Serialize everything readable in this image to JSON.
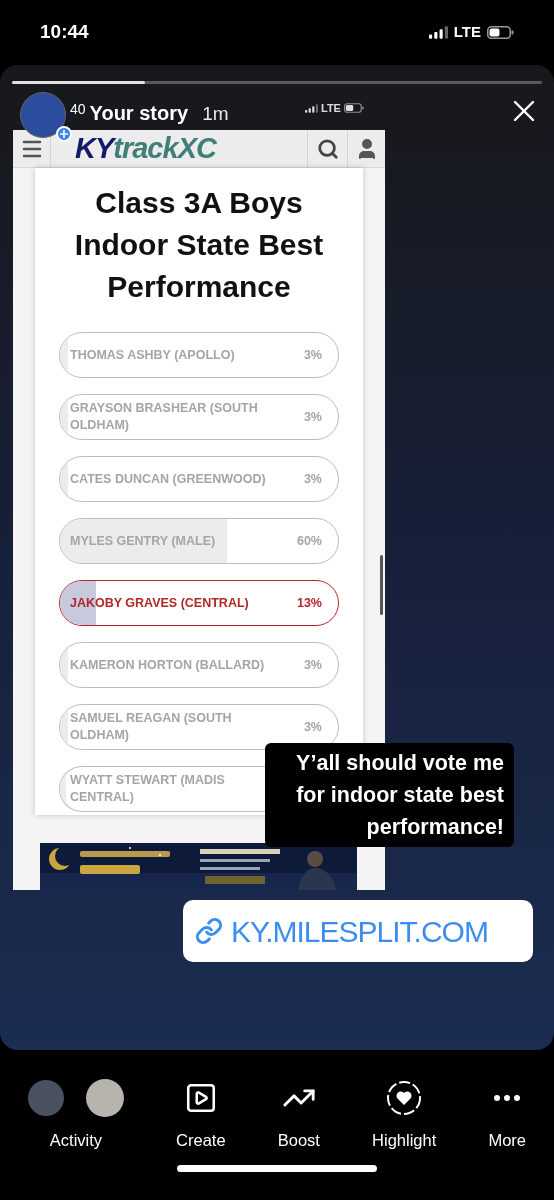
{
  "status_bar": {
    "time": "10:44",
    "network": "LTE"
  },
  "story": {
    "progress": {
      "level": 0.25
    },
    "hidden_time": "40",
    "title": "Your story",
    "age": "1m",
    "inner_network": "LTE"
  },
  "site": {
    "logo_prefix": "KY",
    "logo_rest": "trackXC"
  },
  "poll": {
    "title": "Class 3A Boys Indoor State Best Performance",
    "options": [
      {
        "lines": [
          "THOMAS ASHBY (APOLLO)"
        ],
        "percent": "3%",
        "level": 0.03,
        "selected": false
      },
      {
        "lines": [
          "GRAYSON BRASHEAR (SOUTH",
          "OLDHAM)"
        ],
        "percent": "3%",
        "level": 0.03,
        "selected": false
      },
      {
        "lines": [
          "CATES DUNCAN (GREENWOOD)"
        ],
        "percent": "3%",
        "level": 0.03,
        "selected": false
      },
      {
        "lines": [
          "MYLES GENTRY (MALE)"
        ],
        "percent": "60%",
        "level": 0.6,
        "selected": false
      },
      {
        "lines": [
          "JAKOBY GRAVES (CENTRAL)"
        ],
        "percent": "13%",
        "level": 0.13,
        "selected": true
      },
      {
        "lines": [
          "KAMERON HORTON (BALLARD)"
        ],
        "percent": "3%",
        "level": 0.03,
        "selected": false
      },
      {
        "lines": [
          "SAMUEL REAGAN (SOUTH",
          "OLDHAM)"
        ],
        "percent": "3%",
        "level": 0.03,
        "selected": false
      },
      {
        "lines": [
          "WYATT STEWART (MADIS",
          "CENTRAL)"
        ],
        "level": 0.03,
        "selected": false
      }
    ]
  },
  "caption": {
    "lines": [
      "Y’all should vote me",
      "for indoor state best",
      "performance!"
    ]
  },
  "link_sticker": {
    "text": "KY.MILESPLIT.COM"
  },
  "bottom_bar": {
    "items": [
      {
        "kind": "avatars",
        "label": "Activity"
      },
      {
        "kind": "create",
        "label": "Create"
      },
      {
        "kind": "boost",
        "label": "Boost"
      },
      {
        "kind": "highlight",
        "label": "Highlight"
      },
      {
        "kind": "more",
        "label": "More"
      }
    ]
  }
}
